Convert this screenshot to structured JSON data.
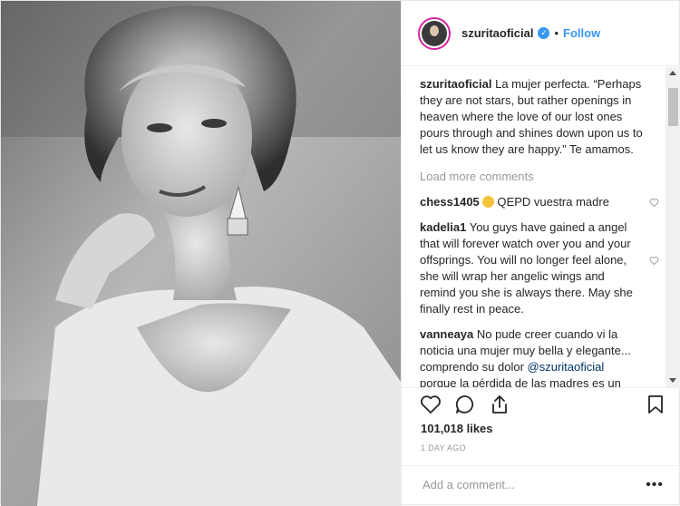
{
  "post": {
    "username": "szuritaoficial",
    "follow_label": "Follow",
    "separator": "•",
    "caption": {
      "username": "szuritaoficial",
      "text": "La mujer perfecta. “Perhaps they are not stars, but rather openings in heaven where the love of our lost ones pours through and shines down upon us to let us know they are happy.” Te amamos."
    },
    "load_more_label": "Load more comments",
    "comments": [
      {
        "username": "chess1405",
        "text": "QEPD vuestra madre"
      },
      {
        "username": "kadelia1",
        "text": "You guys have gained a angel that will forever watch over you and your offsprings. You will no longer feel alone, she will wrap her angelic wings and remind you she is always there. May she finally rest in peace."
      },
      {
        "username": "vanneaya",
        "text": "No pude creer cuando vi la noticia una mujer muy bella y elegante... comprendo su dolor",
        "mention": "@szuritaoficial",
        "text2": "porque la pérdida de las madres es un dolor incomparable"
      }
    ],
    "likes": "101,018 likes",
    "timestamp": "1 DAY AGO",
    "add_comment_placeholder": "Add a comment...",
    "more_label": "•••"
  },
  "icons": {
    "like": "heart-icon",
    "comment": "comment-icon",
    "share": "share-icon",
    "save": "bookmark-icon",
    "verified": "verified-badge-icon"
  },
  "colors": {
    "link": "#3897f0",
    "text": "#262626",
    "muted": "#999999",
    "verified": "#3897f0",
    "mention": "#003569"
  }
}
